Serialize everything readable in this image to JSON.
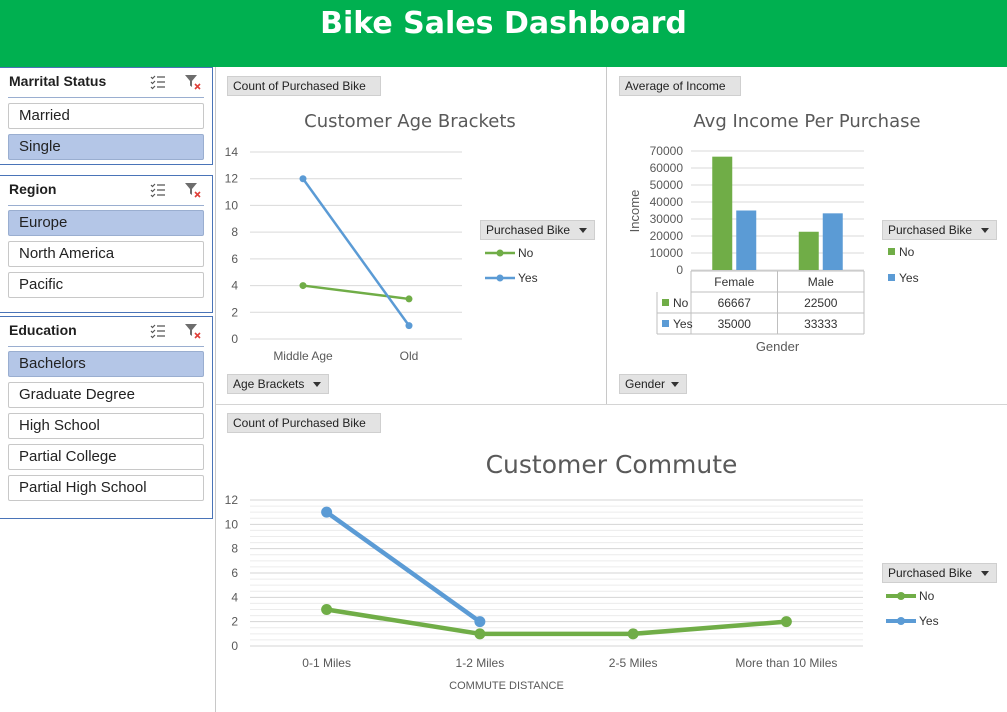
{
  "header": {
    "title": "Bike Sales Dashboard"
  },
  "slicers": {
    "marital": {
      "title": "Marrital Status",
      "items": [
        {
          "label": "Married",
          "selected": false
        },
        {
          "label": "Single",
          "selected": true
        }
      ]
    },
    "region": {
      "title": "Region",
      "items": [
        {
          "label": "Europe",
          "selected": true
        },
        {
          "label": "North America",
          "selected": false
        },
        {
          "label": "Pacific",
          "selected": false
        }
      ]
    },
    "education": {
      "title": "Education",
      "items": [
        {
          "label": "Bachelors",
          "selected": true
        },
        {
          "label": "Graduate Degree",
          "selected": false
        },
        {
          "label": "High School",
          "selected": false
        },
        {
          "label": "Partial College",
          "selected": false
        },
        {
          "label": "Partial High School",
          "selected": false
        }
      ]
    }
  },
  "pivot_buttons": {
    "age_values": "Count of Purchased Bike",
    "age_axis": "Age Brackets",
    "income_values": "Average of Income",
    "income_axis": "Gender",
    "commute_values": "Count of Purchased Bike",
    "legend_field": "Purchased Bike"
  },
  "colors": {
    "no": "#70ad47",
    "yes": "#5b9bd5",
    "banner": "#00b050"
  },
  "chart_data": [
    {
      "type": "line",
      "title": "Customer Age Brackets",
      "categories": [
        "Middle Age",
        "Old"
      ],
      "series": [
        {
          "name": "No",
          "values": [
            4,
            3
          ]
        },
        {
          "name": "Yes",
          "values": [
            12,
            1
          ]
        }
      ],
      "ylim": [
        0,
        14
      ],
      "yticks": [
        0,
        2,
        4,
        6,
        8,
        10,
        12,
        14
      ],
      "xlabel": "",
      "ylabel": "",
      "grid": true,
      "legend_title": "Purchased Bike",
      "legend_position": "right"
    },
    {
      "type": "bar",
      "title": "Avg Income Per Purchase",
      "categories": [
        "Female",
        "Male"
      ],
      "series": [
        {
          "name": "No",
          "values": [
            66667,
            22500
          ]
        },
        {
          "name": "Yes",
          "values": [
            35000,
            33333
          ]
        }
      ],
      "ylim": [
        0,
        70000
      ],
      "yticks": [
        0,
        10000,
        20000,
        30000,
        40000,
        50000,
        60000,
        70000
      ],
      "xlabel": "Gender",
      "ylabel": "Income",
      "grid": true,
      "data_table": true,
      "legend_title": "Purchased Bike",
      "legend_position": "right"
    },
    {
      "type": "line",
      "title": "Customer Commute",
      "categories": [
        "0-1 Miles",
        "1-2 Miles",
        "2-5 Miles",
        "More than 10 Miles"
      ],
      "series": [
        {
          "name": "No",
          "values": [
            3,
            1,
            1,
            2
          ]
        },
        {
          "name": "Yes",
          "values": [
            11,
            2
          ]
        }
      ],
      "ylim": [
        0,
        12
      ],
      "yticks": [
        0,
        2,
        4,
        6,
        8,
        10,
        12
      ],
      "xlabel": "COMMUTE DISTANCE",
      "ylabel": "",
      "grid": true,
      "legend_title": "Purchased Bike",
      "legend_position": "right"
    }
  ]
}
